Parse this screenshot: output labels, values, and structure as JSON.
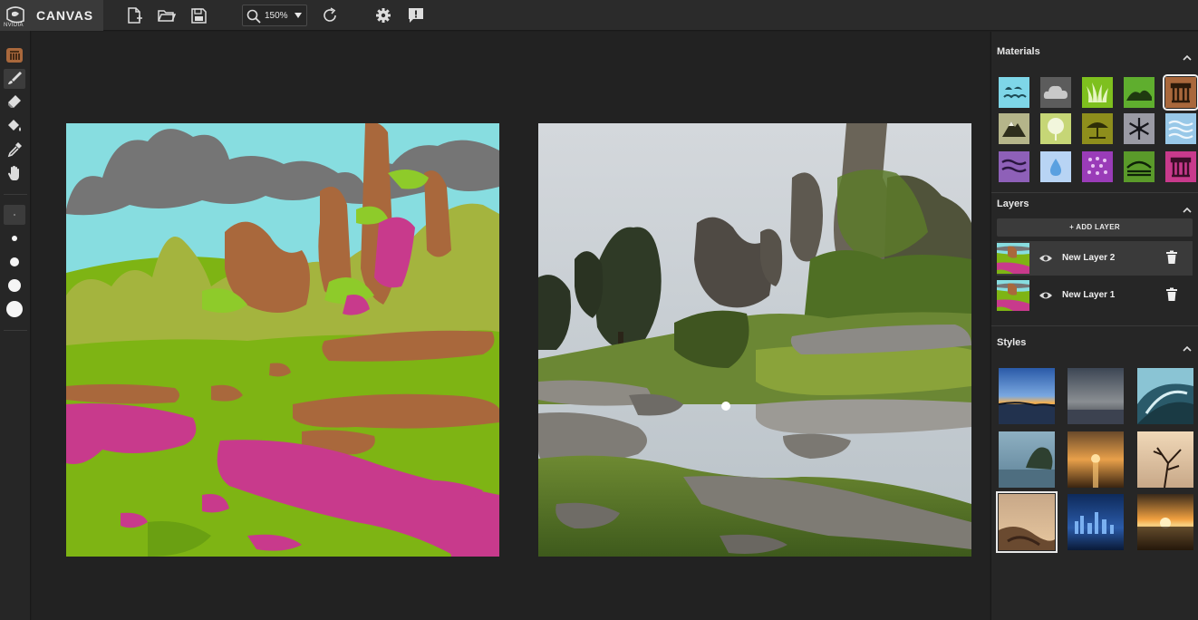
{
  "app": {
    "brand": "NVIDIA",
    "title": "CANVAS"
  },
  "toolbar": {
    "zoom_value": "150%",
    "icons": [
      "new-file-icon",
      "open-folder-icon",
      "save-icon",
      "zoom-icon",
      "reset-icon",
      "settings-icon",
      "feedback-icon"
    ]
  },
  "tools": [
    "material-picker-icon",
    "brush-icon",
    "eraser-icon",
    "fill-bucket-icon",
    "eyedropper-icon",
    "pan-hand-icon"
  ],
  "panel": {
    "materials_title": "Materials",
    "layers_title": "Layers",
    "styles_title": "Styles",
    "add_layer_label": "+ ADD LAYER"
  },
  "materials": [
    {
      "name": "sea",
      "color": "#7ed6e8"
    },
    {
      "name": "cloud",
      "color": "#c8c8c8"
    },
    {
      "name": "grass",
      "color": "#7ec01e"
    },
    {
      "name": "hill",
      "color": "#5fae2e"
    },
    {
      "name": "mountain",
      "color": "#a9683c"
    },
    {
      "name": "rock",
      "color": "#b5b58a"
    },
    {
      "name": "tree",
      "color": "#c6d676"
    },
    {
      "name": "bush",
      "color": "#8e8e1c"
    },
    {
      "name": "snow",
      "color": "#9a9aa4"
    },
    {
      "name": "water",
      "color": "#98c8e8"
    },
    {
      "name": "river",
      "color": "#8e60b8"
    },
    {
      "name": "ice",
      "color": "#b8d4f4"
    },
    {
      "name": "flower",
      "color": "#9a3cb8"
    },
    {
      "name": "ground",
      "color": "#5a9a2a"
    },
    {
      "name": "cliff",
      "color": "#c83a8c"
    }
  ],
  "layers": [
    {
      "name": "New Layer 2",
      "selected": true
    },
    {
      "name": "New Layer 1",
      "selected": false
    }
  ],
  "styles_count": 9
}
